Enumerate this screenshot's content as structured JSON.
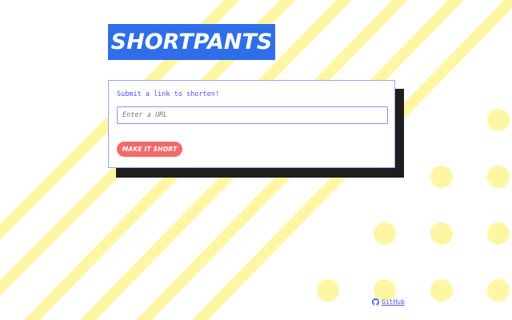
{
  "app": {
    "logo_text": "SHORTPANTS"
  },
  "form": {
    "label": "Submit a link to shorten!",
    "input_placeholder": "Enter a URL",
    "input_value": "",
    "submit_label": "MAKE IT SHORT"
  },
  "footer": {
    "github_label": "GitHub",
    "github_icon": "github-icon"
  },
  "colors": {
    "brand": "#2f6ee8",
    "accent_button": "#f26a6a",
    "link": "#4a55ff",
    "pattern": "#fff6a3"
  }
}
